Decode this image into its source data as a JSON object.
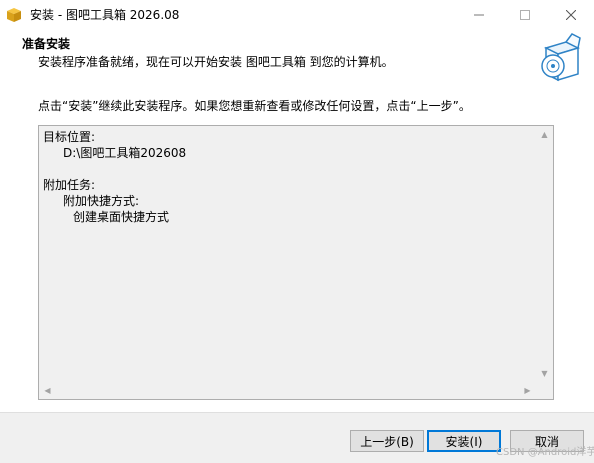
{
  "window": {
    "title": "安装 - 图吧工具箱 2026.08"
  },
  "header": {
    "title": "准备安装",
    "subtitle": "安装程序准备就绪，现在可以开始安装 图吧工具箱 到您的计算机。"
  },
  "instruction": "点击“安装”继续此安装程序。如果您想重新查看或修改任何设置，点击“上一步”。",
  "memo": {
    "dest_label": "目标位置:",
    "dest_value": "D:\\图吧工具箱202608",
    "tasks_label": "附加任务:",
    "shortcut_label": "附加快捷方式:",
    "shortcut_item": "创建桌面快捷方式"
  },
  "buttons": {
    "back": "上一步(B)",
    "install": "安装(I)",
    "cancel": "取消"
  },
  "watermark": "CSDN @Android洋芋",
  "icons": {
    "app": "installer-box-icon",
    "wizard": "box-with-disc-icon"
  },
  "colors": {
    "focus_border": "#0078d7",
    "footer_bg": "#f0f0f0",
    "button_bg": "#e1e1e1"
  }
}
